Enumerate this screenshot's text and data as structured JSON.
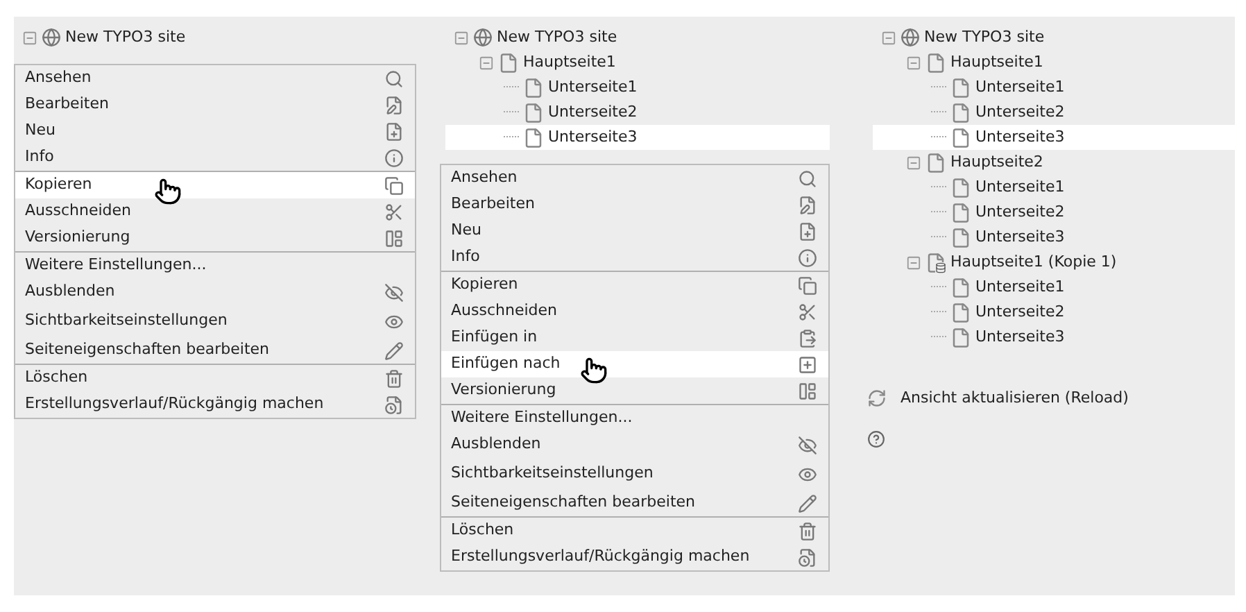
{
  "panels": [
    {
      "tree": [
        {
          "label": "New TYPO3 site",
          "kind": "site",
          "expanded": true,
          "selected": false
        }
      ],
      "menu": {
        "sections": [
          [
            {
              "label": "Ansehen",
              "kind": "view",
              "hovered": false
            },
            {
              "label": "Bearbeiten",
              "kind": "edit",
              "hovered": false
            },
            {
              "label": "Neu",
              "kind": "new",
              "hovered": false
            },
            {
              "label": "Info",
              "kind": "info",
              "hovered": false
            }
          ],
          [
            {
              "label": "Kopieren",
              "kind": "copy",
              "hovered": true
            },
            {
              "label": "Ausschneiden",
              "kind": "cut",
              "hovered": false
            },
            {
              "label": "Versionierung",
              "kind": "version",
              "hovered": false
            }
          ],
          [
            {
              "label": "Weitere Einstellungen...",
              "kind": "submenu",
              "hovered": false
            },
            {
              "label": "Ausblenden",
              "kind": "hide",
              "hovered": false
            },
            {
              "label": "Sichtbarkeitseinstellungen",
              "kind": "visibility",
              "hovered": false
            },
            {
              "label": "Seiteneigenschaften bearbeiten",
              "kind": "properties",
              "hovered": false
            }
          ],
          [
            {
              "label": "Löschen",
              "kind": "delete",
              "hovered": false
            },
            {
              "label": "Erstellungsverlauf/Rückgängig machen",
              "kind": "history",
              "hovered": false
            }
          ]
        ]
      }
    },
    {
      "tree": [
        {
          "label": "New TYPO3 site",
          "kind": "site",
          "expanded": true,
          "selected": false,
          "children": [
            {
              "label": "Hauptseite1",
              "kind": "page",
              "expanded": true,
              "selected": false,
              "children": [
                {
                  "label": "Unterseite1",
                  "kind": "page",
                  "selected": false
                },
                {
                  "label": "Unterseite2",
                  "kind": "page",
                  "selected": false
                },
                {
                  "label": "Unterseite3",
                  "kind": "page",
                  "selected": true
                }
              ]
            }
          ]
        }
      ],
      "menu": {
        "sections": [
          [
            {
              "label": "Ansehen",
              "kind": "view",
              "hovered": false
            },
            {
              "label": "Bearbeiten",
              "kind": "edit",
              "hovered": false
            },
            {
              "label": "Neu",
              "kind": "new",
              "hovered": false
            },
            {
              "label": "Info",
              "kind": "info",
              "hovered": false
            }
          ],
          [
            {
              "label": "Kopieren",
              "kind": "copy",
              "hovered": false
            },
            {
              "label": "Ausschneiden",
              "kind": "cut",
              "hovered": false
            },
            {
              "label": "Einfügen in",
              "kind": "paste-into",
              "hovered": false
            },
            {
              "label": "Einfügen nach",
              "kind": "paste-after",
              "hovered": true
            },
            {
              "label": "Versionierung",
              "kind": "version",
              "hovered": false
            }
          ],
          [
            {
              "label": "Weitere Einstellungen...",
              "kind": "submenu",
              "hovered": false
            },
            {
              "label": "Ausblenden",
              "kind": "hide",
              "hovered": false
            },
            {
              "label": "Sichtbarkeitseinstellungen",
              "kind": "visibility",
              "hovered": false
            },
            {
              "label": "Seiteneigenschaften bearbeiten",
              "kind": "properties",
              "hovered": false
            }
          ],
          [
            {
              "label": "Löschen",
              "kind": "delete",
              "hovered": false
            },
            {
              "label": "Erstellungsverlauf/Rückgängig machen",
              "kind": "history",
              "hovered": false
            }
          ]
        ]
      }
    },
    {
      "tree": [
        {
          "label": "New TYPO3 site",
          "kind": "site",
          "expanded": true,
          "selected": false,
          "children": [
            {
              "label": "Hauptseite1",
              "kind": "page",
              "expanded": true,
              "selected": false,
              "children": [
                {
                  "label": "Unterseite1",
                  "kind": "page",
                  "selected": false
                },
                {
                  "label": "Unterseite2",
                  "kind": "page",
                  "selected": false
                },
                {
                  "label": "Unterseite3",
                  "kind": "page",
                  "selected": true
                }
              ]
            },
            {
              "label": "Hauptseite2",
              "kind": "page",
              "expanded": true,
              "selected": false,
              "children": [
                {
                  "label": "Unterseite1",
                  "kind": "page",
                  "selected": false
                },
                {
                  "label": "Unterseite2",
                  "kind": "page",
                  "selected": false
                },
                {
                  "label": "Unterseite3",
                  "kind": "page",
                  "selected": false
                }
              ]
            },
            {
              "label": "Hauptseite1 (Kopie 1)",
              "kind": "page-copy",
              "expanded": true,
              "selected": false,
              "children": [
                {
                  "label": "Unterseite1",
                  "kind": "page",
                  "selected": false
                },
                {
                  "label": "Unterseite2",
                  "kind": "page",
                  "selected": false
                },
                {
                  "label": "Unterseite3",
                  "kind": "page",
                  "selected": false
                }
              ]
            }
          ]
        }
      ],
      "reload": "Ansicht aktualisieren (Reload)",
      "help": true
    }
  ]
}
